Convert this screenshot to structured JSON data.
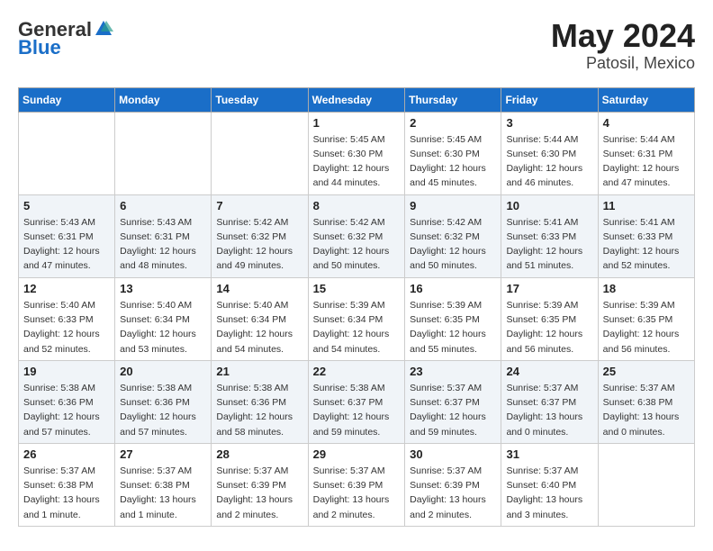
{
  "header": {
    "logo_general": "General",
    "logo_blue": "Blue",
    "month_year": "May 2024",
    "location": "Patosil, Mexico"
  },
  "days_of_week": [
    "Sunday",
    "Monday",
    "Tuesday",
    "Wednesday",
    "Thursday",
    "Friday",
    "Saturday"
  ],
  "weeks": [
    [
      {
        "day": "",
        "info": ""
      },
      {
        "day": "",
        "info": ""
      },
      {
        "day": "",
        "info": ""
      },
      {
        "day": "1",
        "info": "Sunrise: 5:45 AM\nSunset: 6:30 PM\nDaylight: 12 hours\nand 44 minutes."
      },
      {
        "day": "2",
        "info": "Sunrise: 5:45 AM\nSunset: 6:30 PM\nDaylight: 12 hours\nand 45 minutes."
      },
      {
        "day": "3",
        "info": "Sunrise: 5:44 AM\nSunset: 6:30 PM\nDaylight: 12 hours\nand 46 minutes."
      },
      {
        "day": "4",
        "info": "Sunrise: 5:44 AM\nSunset: 6:31 PM\nDaylight: 12 hours\nand 47 minutes."
      }
    ],
    [
      {
        "day": "5",
        "info": "Sunrise: 5:43 AM\nSunset: 6:31 PM\nDaylight: 12 hours\nand 47 minutes."
      },
      {
        "day": "6",
        "info": "Sunrise: 5:43 AM\nSunset: 6:31 PM\nDaylight: 12 hours\nand 48 minutes."
      },
      {
        "day": "7",
        "info": "Sunrise: 5:42 AM\nSunset: 6:32 PM\nDaylight: 12 hours\nand 49 minutes."
      },
      {
        "day": "8",
        "info": "Sunrise: 5:42 AM\nSunset: 6:32 PM\nDaylight: 12 hours\nand 50 minutes."
      },
      {
        "day": "9",
        "info": "Sunrise: 5:42 AM\nSunset: 6:32 PM\nDaylight: 12 hours\nand 50 minutes."
      },
      {
        "day": "10",
        "info": "Sunrise: 5:41 AM\nSunset: 6:33 PM\nDaylight: 12 hours\nand 51 minutes."
      },
      {
        "day": "11",
        "info": "Sunrise: 5:41 AM\nSunset: 6:33 PM\nDaylight: 12 hours\nand 52 minutes."
      }
    ],
    [
      {
        "day": "12",
        "info": "Sunrise: 5:40 AM\nSunset: 6:33 PM\nDaylight: 12 hours\nand 52 minutes."
      },
      {
        "day": "13",
        "info": "Sunrise: 5:40 AM\nSunset: 6:34 PM\nDaylight: 12 hours\nand 53 minutes."
      },
      {
        "day": "14",
        "info": "Sunrise: 5:40 AM\nSunset: 6:34 PM\nDaylight: 12 hours\nand 54 minutes."
      },
      {
        "day": "15",
        "info": "Sunrise: 5:39 AM\nSunset: 6:34 PM\nDaylight: 12 hours\nand 54 minutes."
      },
      {
        "day": "16",
        "info": "Sunrise: 5:39 AM\nSunset: 6:35 PM\nDaylight: 12 hours\nand 55 minutes."
      },
      {
        "day": "17",
        "info": "Sunrise: 5:39 AM\nSunset: 6:35 PM\nDaylight: 12 hours\nand 56 minutes."
      },
      {
        "day": "18",
        "info": "Sunrise: 5:39 AM\nSunset: 6:35 PM\nDaylight: 12 hours\nand 56 minutes."
      }
    ],
    [
      {
        "day": "19",
        "info": "Sunrise: 5:38 AM\nSunset: 6:36 PM\nDaylight: 12 hours\nand 57 minutes."
      },
      {
        "day": "20",
        "info": "Sunrise: 5:38 AM\nSunset: 6:36 PM\nDaylight: 12 hours\nand 57 minutes."
      },
      {
        "day": "21",
        "info": "Sunrise: 5:38 AM\nSunset: 6:36 PM\nDaylight: 12 hours\nand 58 minutes."
      },
      {
        "day": "22",
        "info": "Sunrise: 5:38 AM\nSunset: 6:37 PM\nDaylight: 12 hours\nand 59 minutes."
      },
      {
        "day": "23",
        "info": "Sunrise: 5:37 AM\nSunset: 6:37 PM\nDaylight: 12 hours\nand 59 minutes."
      },
      {
        "day": "24",
        "info": "Sunrise: 5:37 AM\nSunset: 6:37 PM\nDaylight: 13 hours\nand 0 minutes."
      },
      {
        "day": "25",
        "info": "Sunrise: 5:37 AM\nSunset: 6:38 PM\nDaylight: 13 hours\nand 0 minutes."
      }
    ],
    [
      {
        "day": "26",
        "info": "Sunrise: 5:37 AM\nSunset: 6:38 PM\nDaylight: 13 hours\nand 1 minute."
      },
      {
        "day": "27",
        "info": "Sunrise: 5:37 AM\nSunset: 6:38 PM\nDaylight: 13 hours\nand 1 minute."
      },
      {
        "day": "28",
        "info": "Sunrise: 5:37 AM\nSunset: 6:39 PM\nDaylight: 13 hours\nand 2 minutes."
      },
      {
        "day": "29",
        "info": "Sunrise: 5:37 AM\nSunset: 6:39 PM\nDaylight: 13 hours\nand 2 minutes."
      },
      {
        "day": "30",
        "info": "Sunrise: 5:37 AM\nSunset: 6:39 PM\nDaylight: 13 hours\nand 2 minutes."
      },
      {
        "day": "31",
        "info": "Sunrise: 5:37 AM\nSunset: 6:40 PM\nDaylight: 13 hours\nand 3 minutes."
      },
      {
        "day": "",
        "info": ""
      }
    ]
  ]
}
